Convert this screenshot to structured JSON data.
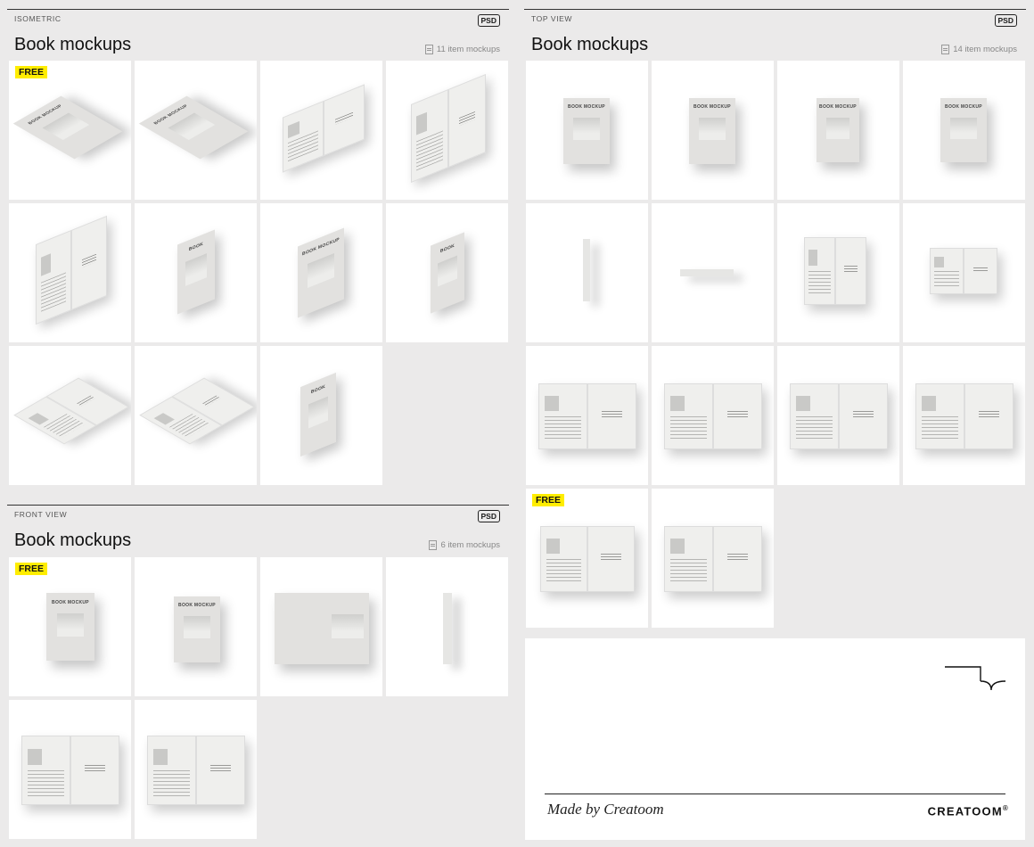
{
  "isometric": {
    "section_label": "ISOMETRIC",
    "format": "PSD",
    "title": "Book mockups",
    "count": "11 item mockups",
    "free_badge": "FREE"
  },
  "front_view": {
    "section_label": "FRONT VIEW",
    "format": "PSD",
    "title": "Book mockups",
    "count": "6 item mockups",
    "free_badge": "FREE"
  },
  "top_view": {
    "section_label": "TOP VIEW",
    "format": "PSD",
    "title": "Book mockups",
    "count": "14 item mockups",
    "free_badge": "FREE"
  },
  "credits": {
    "made_by": "Made by Creatoom",
    "brand": "CREATOOM",
    "registered": "®"
  },
  "colors": {
    "background": "#ebeaea",
    "badge": "#ffed00",
    "card": "#ffffff"
  }
}
